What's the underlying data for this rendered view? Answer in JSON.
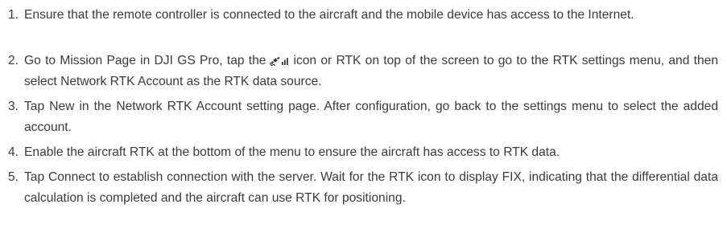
{
  "steps": [
    {
      "number": "1.",
      "text": "Ensure that the remote controller is connected to the aircraft and the mobile device has access to the Internet."
    },
    {
      "number": "2.",
      "text_before_icon": "Go to Mission Page in DJI GS Pro, tap the",
      "icon": "satellite-signal-icon",
      "text_after_icon": "icon or RTK on top of the screen to go to the RTK settings menu, and then select Network RTK Account as the RTK data source."
    },
    {
      "number": "3.",
      "text": "Tap New in the Network RTK Account setting page. After configuration, go back to the settings menu to select the added account."
    },
    {
      "number": "4.",
      "text": "Enable the aircraft RTK at the bottom of the menu to ensure the aircraft has access to RTK data."
    },
    {
      "number": "5.",
      "text": "Tap Connect to establish connection with the server. Wait for the RTK icon to display FIX, indicating that the differential data calculation is completed and the aircraft can use RTK for positioning."
    }
  ]
}
